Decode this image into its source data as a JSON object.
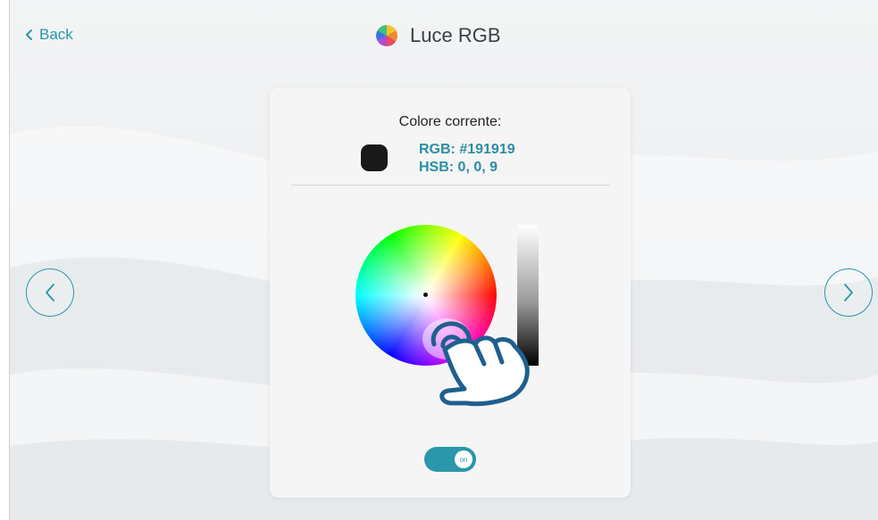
{
  "topbar": {
    "back_label": "Back",
    "title": "Luce RGB",
    "title_icon": "color-wheel-icon"
  },
  "navigation": {
    "prev_icon": "chevron-left-icon",
    "next_icon": "chevron-right-icon"
  },
  "color_card": {
    "current_label": "Colore corrente:",
    "swatch_color": "#191919",
    "rgb_text": "RGB: #191919",
    "hsb_text": "HSB: 0, 0, 9",
    "picker_icon": "color-wheel-icon",
    "brightness_icon": "brightness-slider-icon",
    "gesture_icon": "tap-hand-icon"
  },
  "power_toggle": {
    "state_label": "on",
    "is_on": true
  },
  "colors": {
    "accent": "#2a97aa",
    "value_text": "#2a8fa1"
  }
}
